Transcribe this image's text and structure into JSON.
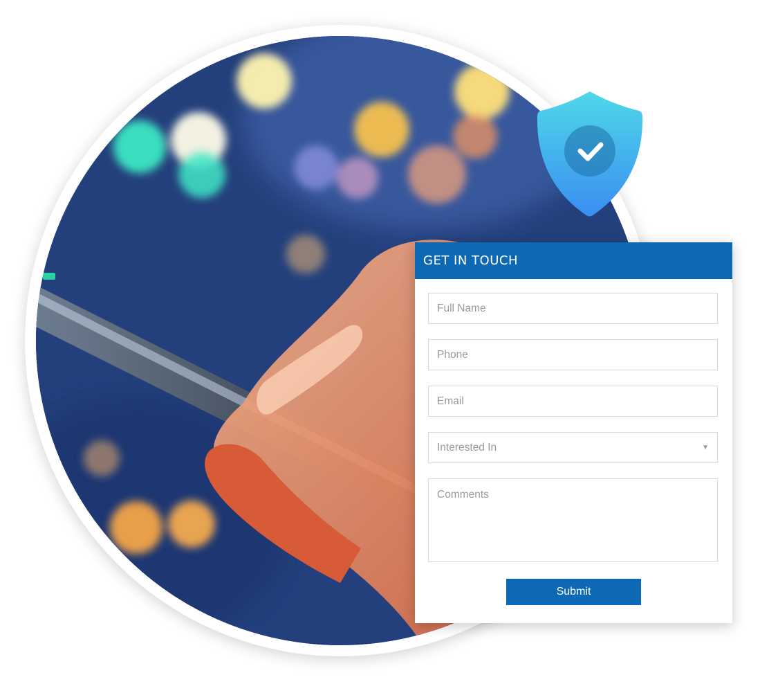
{
  "form": {
    "title": "GET IN TOUCH",
    "fields": {
      "full_name": {
        "placeholder": "Full Name",
        "value": ""
      },
      "phone": {
        "placeholder": "Phone",
        "value": ""
      },
      "email": {
        "placeholder": "Email",
        "value": ""
      },
      "interested_in": {
        "selected": "Interested In"
      },
      "comments": {
        "placeholder": "Comments",
        "value": ""
      }
    },
    "submit_label": "Submit"
  },
  "icons": {
    "shield": "shield-check-icon",
    "dropdown": "chevron-down-icon"
  },
  "colors": {
    "brand_blue": "#0e69b4",
    "shield_top": "#4fd8ea",
    "shield_bottom": "#3a8ef0"
  }
}
